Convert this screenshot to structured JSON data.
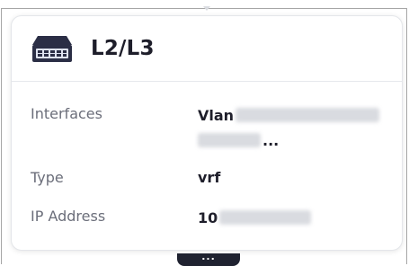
{
  "card": {
    "title": "L2/L3",
    "icon": "network-switch-icon"
  },
  "properties": {
    "interfaces_label": "Interfaces",
    "interfaces_value_prefix": "Vlan",
    "interfaces_truncation": "...",
    "type_label": "Type",
    "type_value": "vrf",
    "ip_label": "IP Address",
    "ip_value_prefix": "10"
  },
  "more_button": {
    "label": "..."
  },
  "colors": {
    "title_text": "#1e1e2a",
    "label_text": "#6b6e7a",
    "icon_body": "#2b2e45",
    "icon_ports": "#dfe3f0",
    "more_tab": "#1f2230"
  }
}
